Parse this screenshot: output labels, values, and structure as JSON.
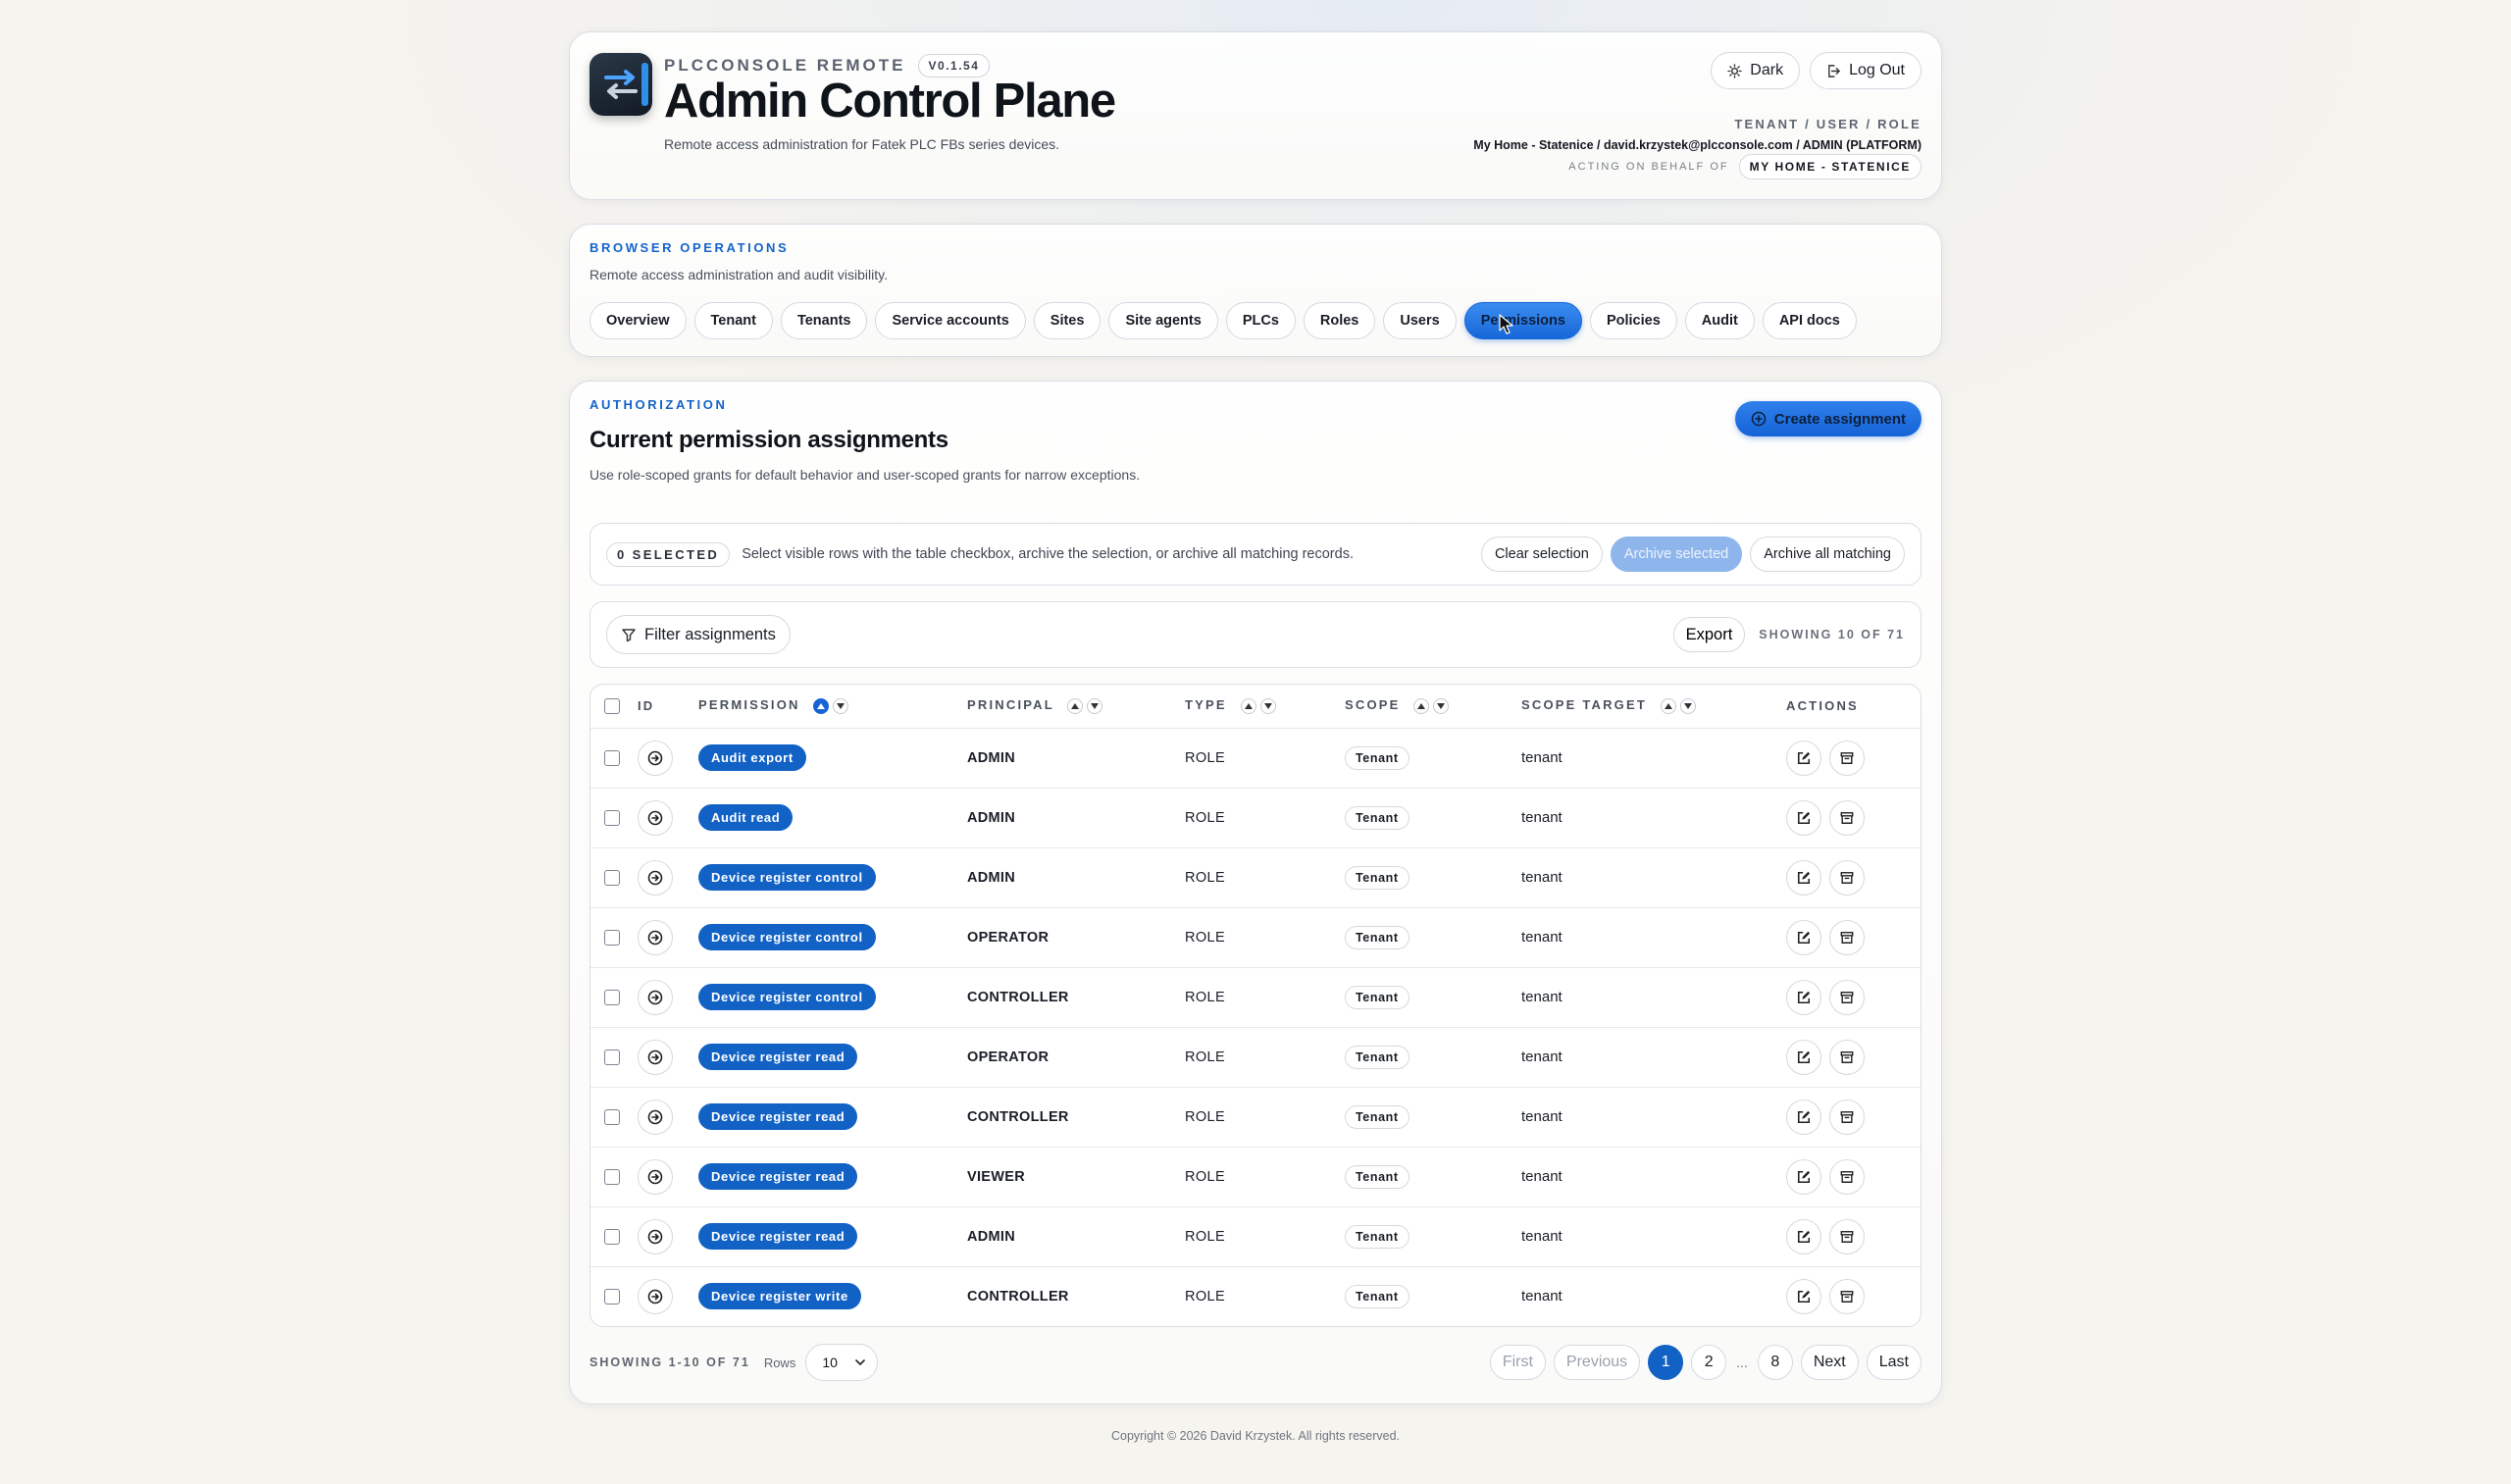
{
  "header": {
    "app_name": "PLCCONSOLE REMOTE",
    "version": "V0.1.54",
    "title": "Admin Control Plane",
    "subtitle": "Remote access administration for Fatek PLC FBs series devices.",
    "theme_button": "Dark",
    "logout_button": "Log Out",
    "tenant_user_role_label": "TENANT / USER / ROLE",
    "tenant_user_role_value": "My Home - Statenice / david.krzystek@plcconsole.com / ADMIN (PLATFORM)",
    "acting_label": "ACTING ON BEHALF OF",
    "acting_value": "MY HOME - STATENICE"
  },
  "nav": {
    "eyebrow": "BROWSER OPERATIONS",
    "description": "Remote access administration and audit visibility.",
    "tabs": [
      "Overview",
      "Tenant",
      "Tenants",
      "Service accounts",
      "Sites",
      "Site agents",
      "PLCs",
      "Roles",
      "Users",
      "Permissions",
      "Policies",
      "Audit",
      "API docs"
    ],
    "active_tab": "Permissions"
  },
  "main": {
    "eyebrow": "AUTHORIZATION",
    "title": "Current permission assignments",
    "description": "Use role-scoped grants for default behavior and user-scoped grants for narrow exceptions.",
    "create_button": "Create assignment",
    "selection": {
      "badge": "0 SELECTED",
      "text": "Select visible rows with the table checkbox, archive the selection, or archive all matching records.",
      "clear": "Clear selection",
      "archive_selected": "Archive selected",
      "archive_all": "Archive all matching"
    },
    "filter": {
      "button": "Filter assignments",
      "export": "Export",
      "showing": "SHOWING 10 OF 71"
    },
    "table": {
      "columns": {
        "id": "ID",
        "permission": "PERMISSION",
        "principal": "PRINCIPAL",
        "type": "TYPE",
        "scope": "SCOPE",
        "scope_target": "SCOPE TARGET",
        "actions": "ACTIONS"
      },
      "rows": [
        {
          "permission": "Audit export",
          "principal": "ADMIN",
          "type": "ROLE",
          "scope": "Tenant",
          "target": "tenant"
        },
        {
          "permission": "Audit read",
          "principal": "ADMIN",
          "type": "ROLE",
          "scope": "Tenant",
          "target": "tenant"
        },
        {
          "permission": "Device register control",
          "principal": "ADMIN",
          "type": "ROLE",
          "scope": "Tenant",
          "target": "tenant"
        },
        {
          "permission": "Device register control",
          "principal": "OPERATOR",
          "type": "ROLE",
          "scope": "Tenant",
          "target": "tenant"
        },
        {
          "permission": "Device register control",
          "principal": "CONTROLLER",
          "type": "ROLE",
          "scope": "Tenant",
          "target": "tenant"
        },
        {
          "permission": "Device register read",
          "principal": "OPERATOR",
          "type": "ROLE",
          "scope": "Tenant",
          "target": "tenant"
        },
        {
          "permission": "Device register read",
          "principal": "CONTROLLER",
          "type": "ROLE",
          "scope": "Tenant",
          "target": "tenant"
        },
        {
          "permission": "Device register read",
          "principal": "VIEWER",
          "type": "ROLE",
          "scope": "Tenant",
          "target": "tenant"
        },
        {
          "permission": "Device register read",
          "principal": "ADMIN",
          "type": "ROLE",
          "scope": "Tenant",
          "target": "tenant"
        },
        {
          "permission": "Device register write",
          "principal": "CONTROLLER",
          "type": "ROLE",
          "scope": "Tenant",
          "target": "tenant"
        }
      ]
    },
    "footer": {
      "showing": "SHOWING 1-10 OF 71",
      "rows_label": "Rows",
      "rows_value": "10",
      "first": "First",
      "previous": "Previous",
      "pages": [
        "1",
        "2"
      ],
      "ellipsis": "...",
      "last_page": "8",
      "next": "Next",
      "last": "Last",
      "current_page": "1"
    }
  },
  "copyright": "Copyright © 2026 David Krzystek. All rights reserved.",
  "colors": {
    "accent": "#1262c6",
    "eyebrow": "#1463c8"
  }
}
